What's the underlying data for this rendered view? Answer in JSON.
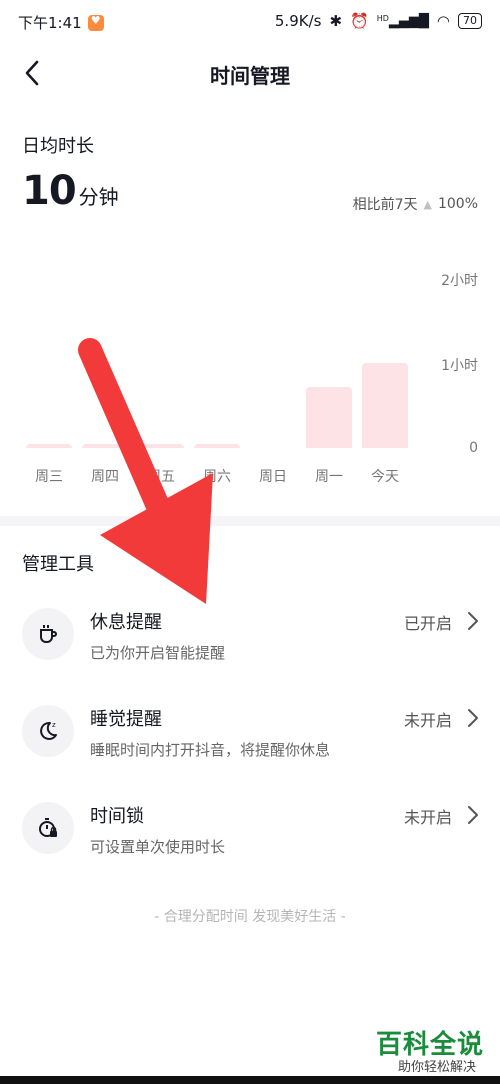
{
  "status_bar": {
    "time": "下午1:41",
    "net_speed": "5.9K/s",
    "signal_tag": "HD",
    "battery": "70"
  },
  "nav": {
    "title": "时间管理"
  },
  "summary": {
    "label": "日均时长",
    "value": "10",
    "unit": "分钟",
    "compare_label": "相比前7天",
    "compare_value": "100%"
  },
  "chart_data": {
    "type": "bar",
    "categories": [
      "周三",
      "周四",
      "周五",
      "周六",
      "周日",
      "周一",
      "今天"
    ],
    "values": [
      3,
      3,
      3,
      3,
      0,
      43,
      60
    ],
    "y_tick_labels": [
      "2小时",
      "1小时",
      "0"
    ],
    "ylim": [
      0,
      120
    ],
    "bar_color": "#fde3e6"
  },
  "tools": {
    "title": "管理工具",
    "items": [
      {
        "title": "休息提醒",
        "desc": "已为你开启智能提醒",
        "status": "已开启",
        "icon": "cup-icon"
      },
      {
        "title": "睡觉提醒",
        "desc": "睡眠时间内打开抖音，将提醒你休息",
        "status": "未开启",
        "icon": "moon-icon"
      },
      {
        "title": "时间锁",
        "desc": "可设置单次使用时长",
        "status": "未开启",
        "icon": "timer-lock-icon"
      }
    ]
  },
  "footer": {
    "note": "- 合理分配时间 发现美好生活 -"
  },
  "watermark": {
    "title": "百科全说",
    "subtitle": "助你轻松解决"
  },
  "colors": {
    "arrow": "#f23a3a",
    "watermark": "#1a8c3c"
  }
}
